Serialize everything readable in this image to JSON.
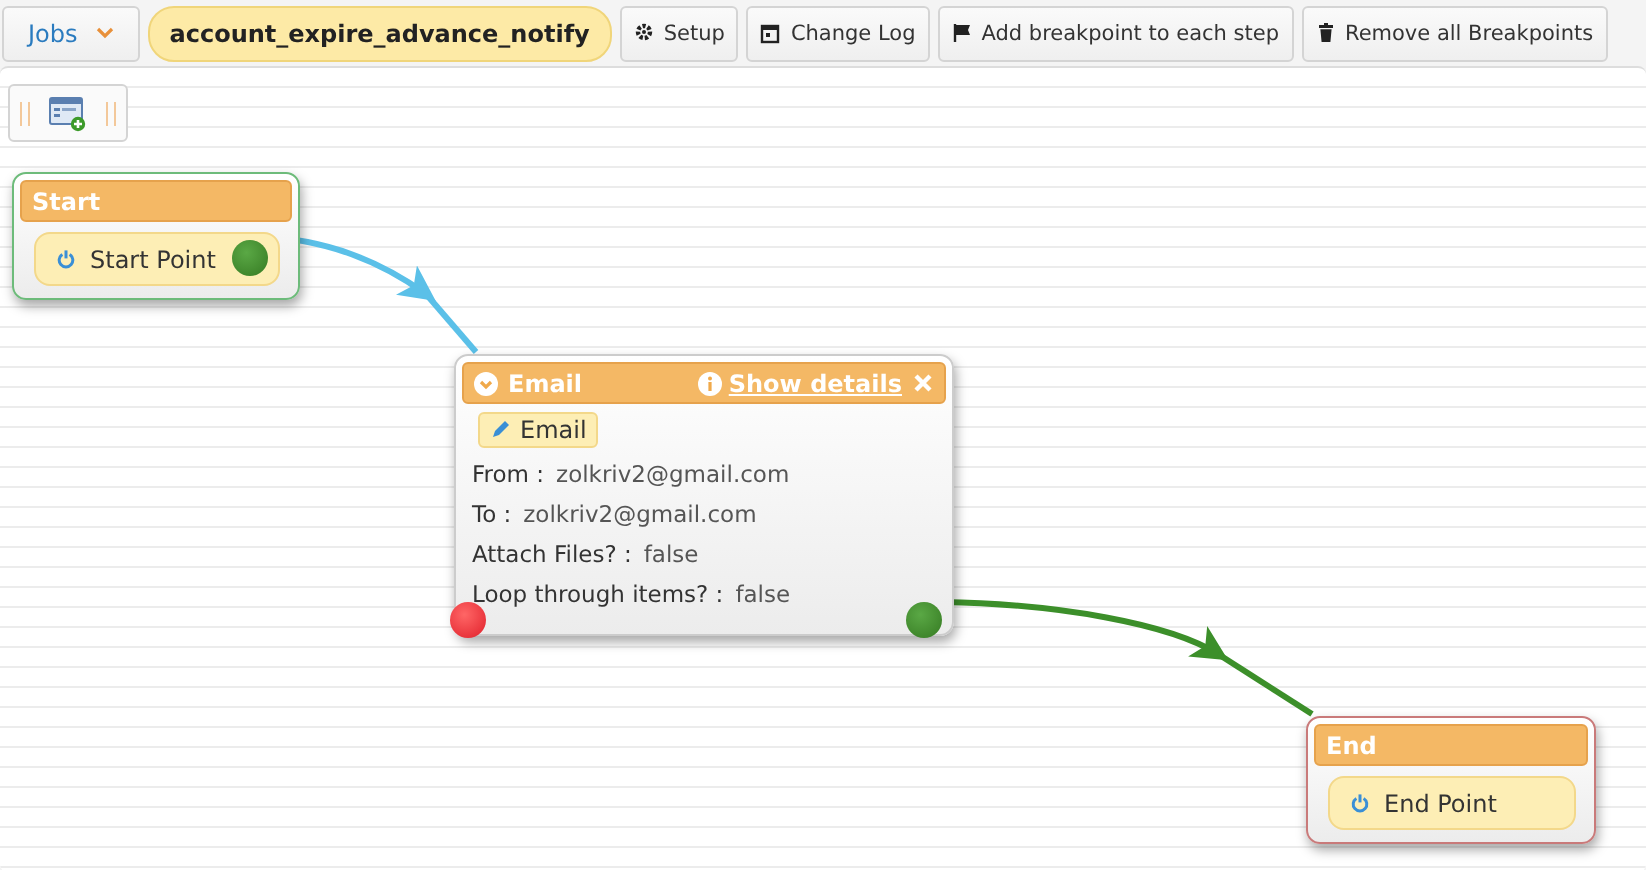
{
  "toolbar": {
    "jobs_menu": "Jobs",
    "job_name": "account_expire_advance_notify",
    "buttons": [
      {
        "label": "Setup"
      },
      {
        "label": "Change Log"
      },
      {
        "label": "Add breakpoint to each step"
      },
      {
        "label": "Remove all Breakpoints"
      }
    ]
  },
  "nodes": [
    {
      "kind": "start",
      "title": "Start",
      "point": "Start Point"
    },
    {
      "kind": "email",
      "title": "Email",
      "details_link": "Show details",
      "pill": "Email",
      "fields": [
        {
          "label": "From :",
          "value": "zolkriv2@gmail.com"
        },
        {
          "label": "To :",
          "value": "zolkriv2@gmail.com"
        },
        {
          "label": "Attach Files? :",
          "value": "false"
        },
        {
          "label": "Loop through items? :",
          "value": "false"
        }
      ]
    },
    {
      "kind": "end",
      "title": "End",
      "point": "End Point"
    }
  ],
  "connections": [
    {
      "color": "#5bc0e8"
    },
    {
      "color": "#3c8f2a"
    }
  ]
}
